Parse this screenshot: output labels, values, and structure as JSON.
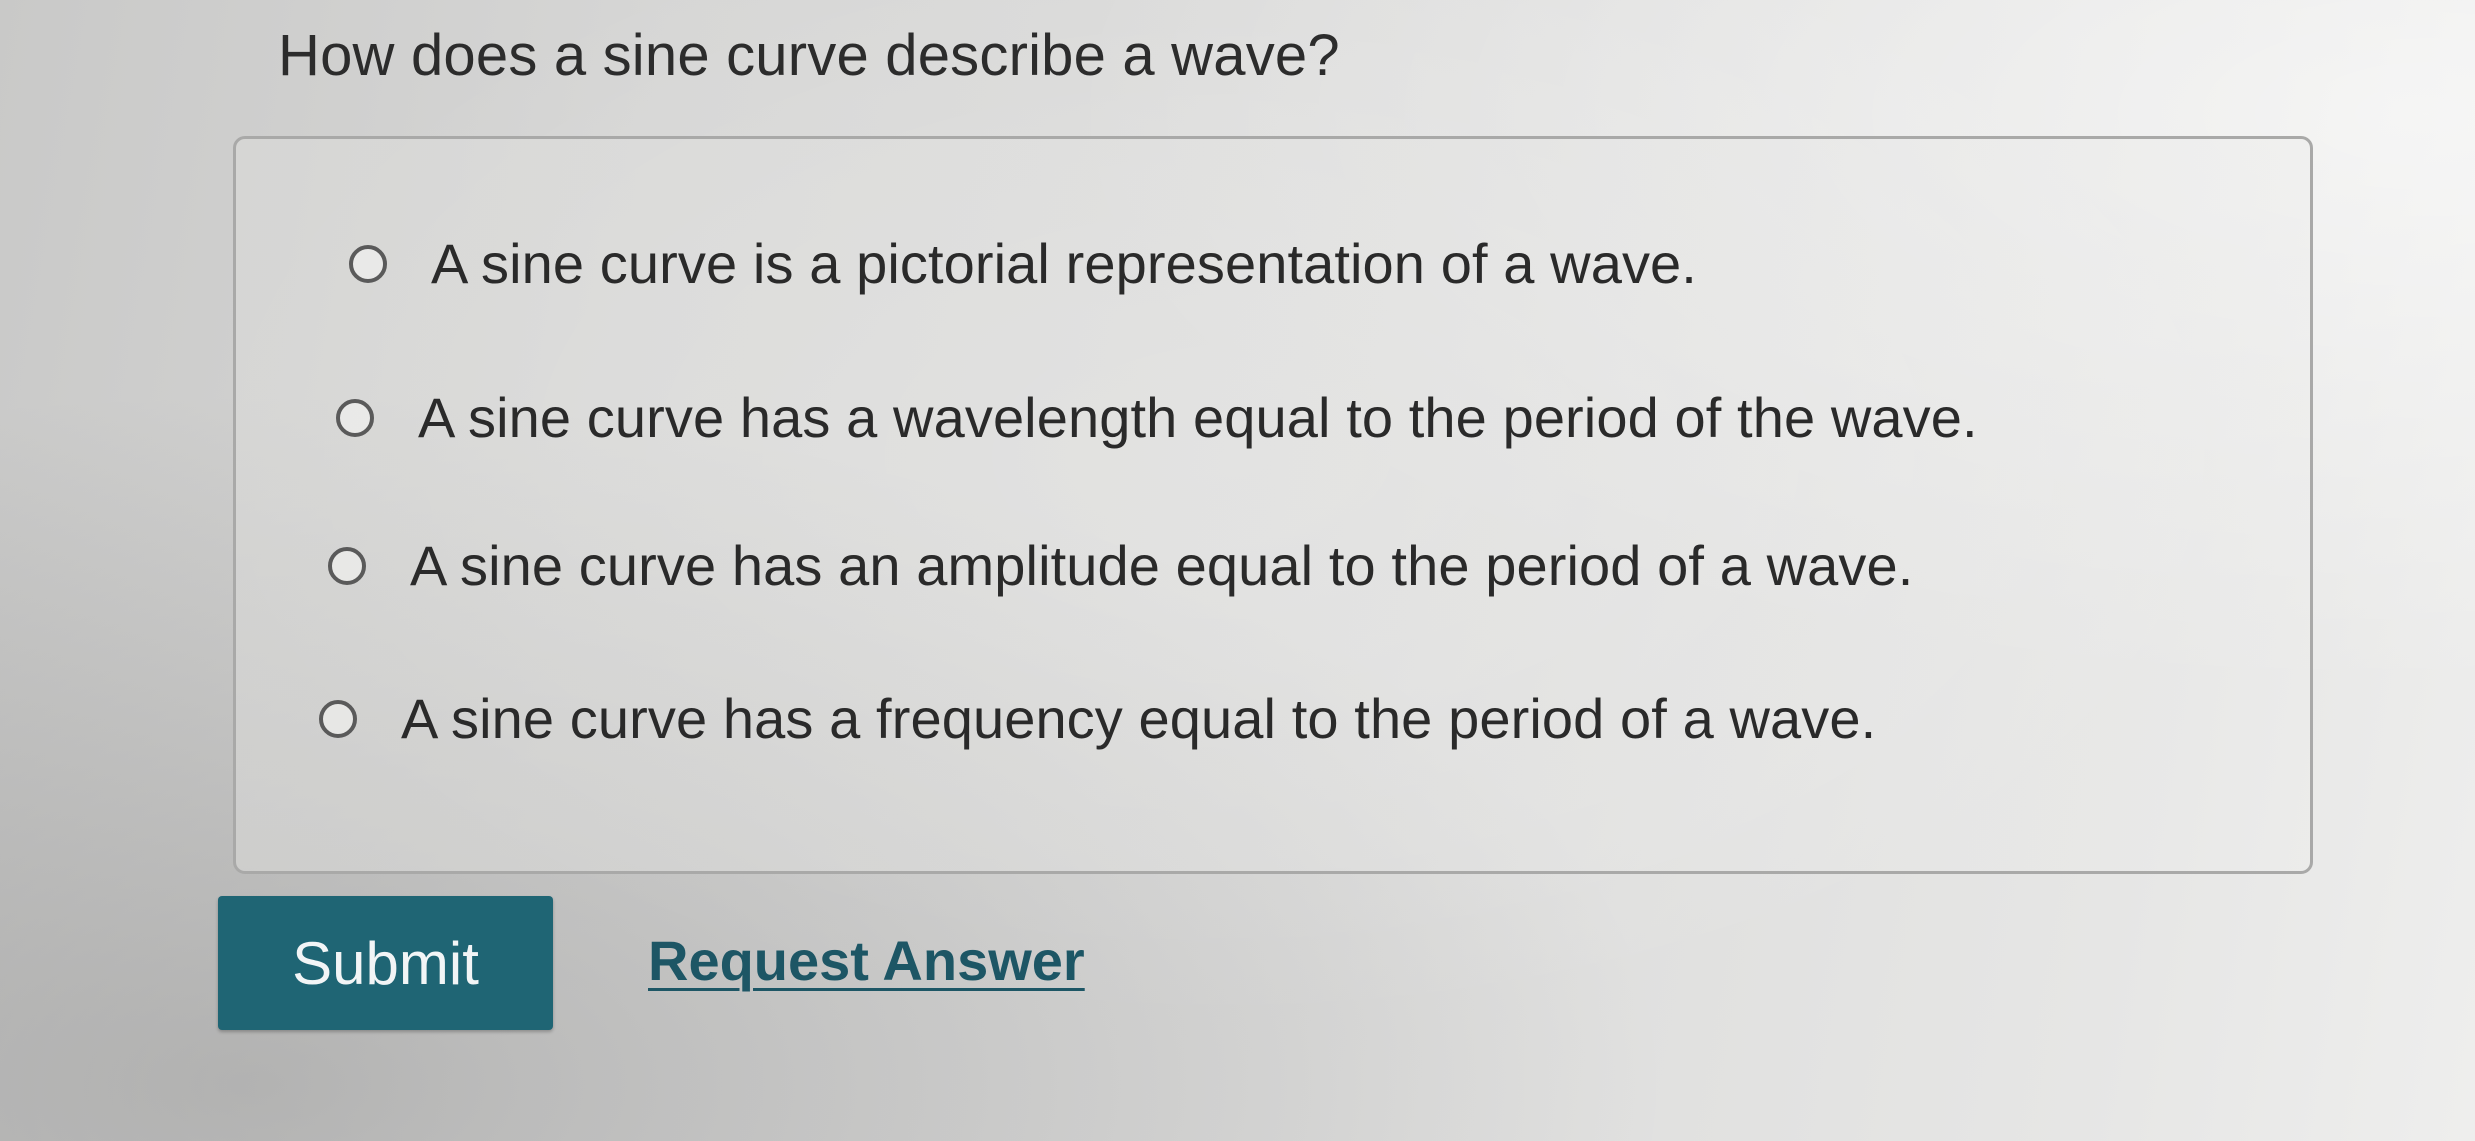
{
  "question": {
    "text": "How does a sine curve describe a wave?"
  },
  "options": [
    {
      "label": "A sine curve is a pictorial representation of a wave.",
      "selected": false
    },
    {
      "label": "A sine curve has a wavelength equal to the period of the wave.",
      "selected": false
    },
    {
      "label": "A sine curve has an amplitude equal to the period of a wave.",
      "selected": false
    },
    {
      "label": "A sine curve has a frequency equal to the period of a wave.",
      "selected": false
    }
  ],
  "actions": {
    "submit_label": "Submit",
    "request_answer_label": "Request Answer"
  },
  "colors": {
    "submit_background": "#1f6574",
    "link": "#1d5665"
  },
  "icons": {
    "radio": "radio-unchecked-icon"
  }
}
